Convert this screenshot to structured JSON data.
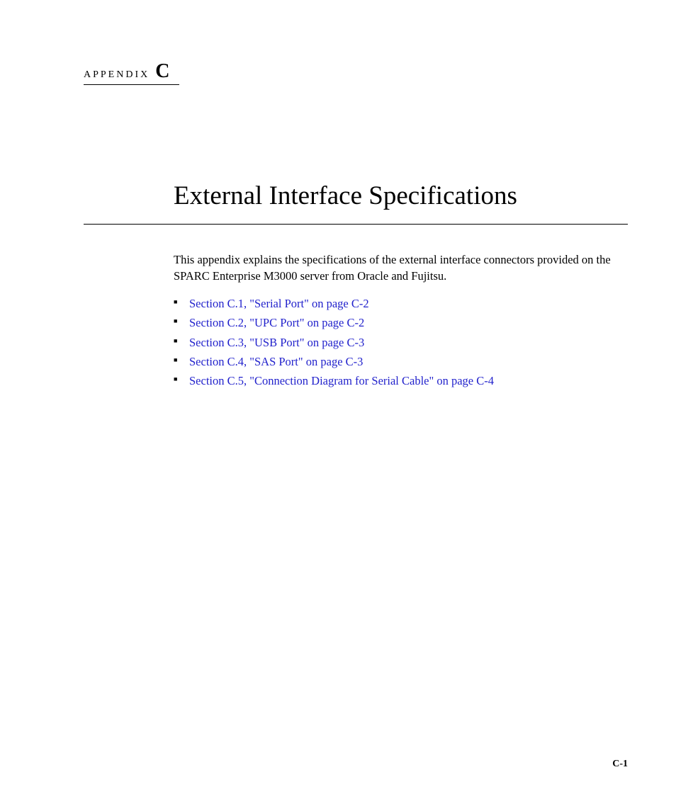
{
  "header": {
    "label": "APPENDIX",
    "letter": "C"
  },
  "title": "External Interface Specifications",
  "intro": "This appendix explains the specifications of the external interface connectors provided on the SPARC Enterprise M3000 server from Oracle and Fujitsu.",
  "links": [
    "Section C.1, \"Serial Port\" on page C-2",
    "Section C.2, \"UPC Port\" on page C-2",
    "Section C.3, \"USB Port\" on page C-3",
    "Section C.4, \"SAS Port\" on page C-3",
    "Section C.5, \"Connection Diagram for Serial Cable\" on page C-4"
  ],
  "page_number": "C-1"
}
